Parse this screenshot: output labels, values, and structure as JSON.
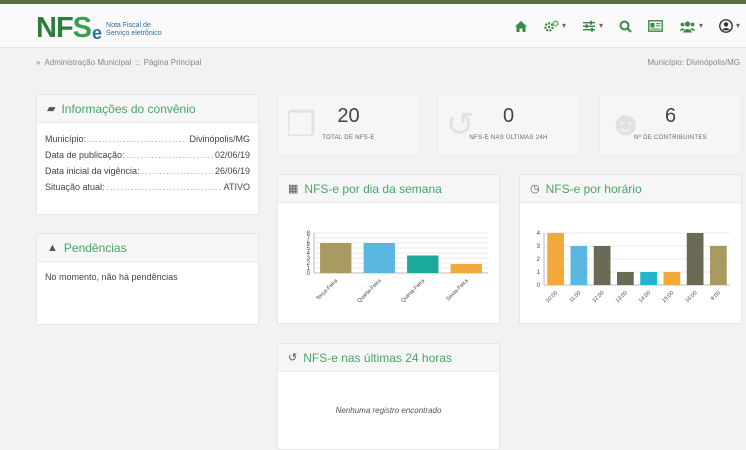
{
  "logo": {
    "nf": "NF",
    "se": "S",
    "e": "e",
    "sub_line1": "Nota Fiscal de",
    "sub_line2": "Serviço eletrônico"
  },
  "header_icons": [
    "home-icon",
    "gears-icon",
    "sliders-icon",
    "search-icon",
    "id-card-icon",
    "users-icon",
    "user-circle-icon"
  ],
  "breadcrumb": {
    "sep": "»",
    "item1": "Administração Municipal",
    "divider": "::",
    "item2": "Página Principal"
  },
  "municipio": "Município: Divinópolis/MG",
  "convenio": {
    "title": "Informações do convênio",
    "rows": [
      {
        "label": "Município:",
        "value": "Divinópolis/MG"
      },
      {
        "label": "Data de publicação:",
        "value": "02/06/19"
      },
      {
        "label": "Data inicial da vigência:",
        "value": "26/06/19"
      },
      {
        "label": "Situação atual:",
        "value": "ATIVO"
      }
    ]
  },
  "pendencias": {
    "title": "Pendências",
    "text": "No momento, não há pendências"
  },
  "stats": [
    {
      "value": "20",
      "caption": "TOTAL DE NFS-E"
    },
    {
      "value": "0",
      "caption": "NFS-E NAS ÚLTIMAS 24H"
    },
    {
      "value": "6",
      "caption": "Nº DE CONTRIBUINTES"
    }
  ],
  "dia_semana": {
    "title": "NFS-e por dia da semana"
  },
  "horario": {
    "title": "NFS-e por horário"
  },
  "ultimas": {
    "title": "NFS-e nas últimas 24 horas",
    "empty": "Nenhuma registro encontrado"
  },
  "chart_data": [
    {
      "type": "bar",
      "categories": [
        "Terça-Feira",
        "Quarta-Feira",
        "Quinta-Feira",
        "Sexta-Feira"
      ],
      "values": [
        6,
        6,
        3.5,
        1.8
      ],
      "colors": [
        "#a89a60",
        "#5ab8e0",
        "#1aa99a",
        "#f2a93b"
      ],
      "ylim": [
        0,
        8
      ],
      "yticks": [
        0,
        1,
        2,
        3,
        4,
        5,
        6,
        7,
        8
      ]
    },
    {
      "type": "bar",
      "categories": [
        "10:00",
        "11:00",
        "12:00",
        "13:00",
        "14:00",
        "15:00",
        "16:00",
        "9:00"
      ],
      "values": [
        4,
        3,
        3,
        1,
        1,
        1,
        4,
        3
      ],
      "colors": [
        "#f2a93b",
        "#5ab8e0",
        "#6b6b55",
        "#6b6b55",
        "#22b5c9",
        "#f2a93b",
        "#6b6b55",
        "#a89a60"
      ],
      "ylim": [
        0,
        4
      ],
      "yticks": [
        0,
        1,
        2,
        3,
        4
      ]
    }
  ]
}
